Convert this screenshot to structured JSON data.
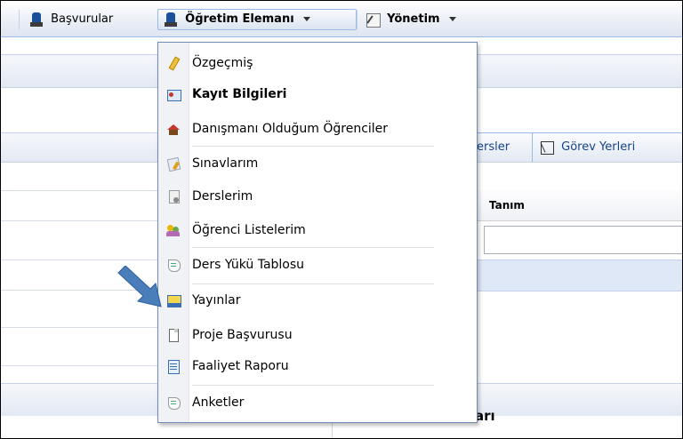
{
  "menubar": {
    "items": [
      {
        "label": "Başvurular",
        "icon": "user-book-icon"
      },
      {
        "label": "Öğretim Elemanı",
        "icon": "user-book-icon"
      },
      {
        "label": "Yönetim",
        "icon": "tools-icon"
      }
    ]
  },
  "tabs": [
    {
      "label": "ersler"
    },
    {
      "label": "Görev Yerleri",
      "icon": "frame-icon"
    }
  ],
  "grid": {
    "column_header": "Tanım",
    "filter_value": ""
  },
  "bottom_panel": {
    "title_fragment": "arı"
  },
  "dropdown": {
    "items": [
      {
        "label": "Özgeçmiş",
        "icon": "pencil-icon",
        "bold": false
      },
      {
        "label": "Kayıt Bilgileri",
        "icon": "id-card-icon",
        "bold": true
      },
      {
        "label": "Danışmanı Olduğum Öğrenciler",
        "icon": "graduation-cap-icon",
        "bold": false
      },
      {
        "label": "Sınavlarım",
        "icon": "exam-paper-icon",
        "bold": false
      },
      {
        "label": "Derslerim",
        "icon": "document-icon",
        "bold": false
      },
      {
        "label": "Öğrenci Listelerim",
        "icon": "people-icon",
        "bold": false
      },
      {
        "label": "Ders Yükü Tablosu",
        "icon": "scroll-icon",
        "bold": false
      },
      {
        "label": "Yayınlar",
        "icon": "publication-icon",
        "bold": false
      },
      {
        "label": "Proje Başvurusu",
        "icon": "page-icon",
        "bold": false
      },
      {
        "label": "Faaliyet Raporu",
        "icon": "report-icon",
        "bold": false
      },
      {
        "label": "Anketler",
        "icon": "scroll-icon",
        "bold": false
      }
    ]
  },
  "colors": {
    "accent": "#15428b",
    "selected_row": "#dfe8f6",
    "pointer_arrow": "#4a7ebb"
  }
}
